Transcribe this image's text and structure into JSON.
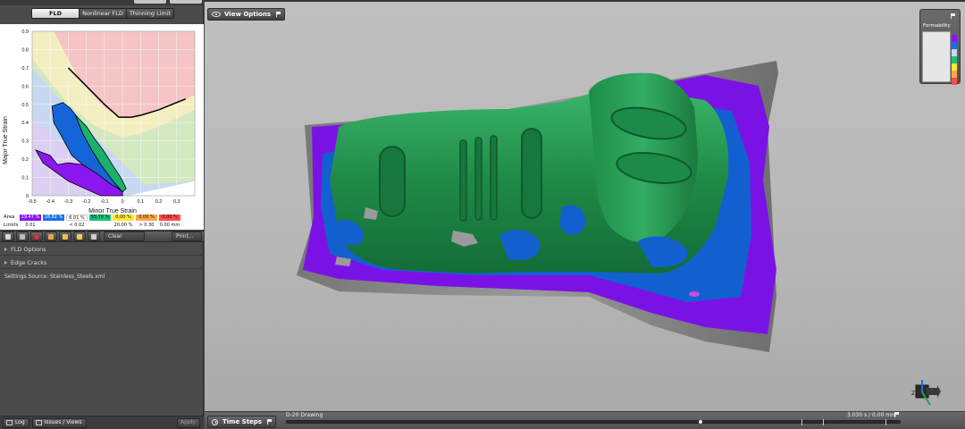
{
  "fld": {
    "tabs": [
      {
        "label": "FLD",
        "active": true
      },
      {
        "label": "Nonlinear FLD",
        "active": false
      },
      {
        "label": "Thinning Limit",
        "active": false
      }
    ],
    "chart_data": {
      "type": "scatter",
      "xlabel": "Minor True Strain",
      "ylabel": "Major True Strain",
      "xlim": [
        -0.5,
        0.4
      ],
      "ylim": [
        0,
        0.9
      ],
      "xticks": [
        "-0.5",
        "-0.4",
        "-0.3",
        "-0.2",
        "-0.1",
        "0",
        "0.1",
        "0.2",
        "0.3"
      ],
      "yticks": [
        "0",
        "0.1",
        "0.2",
        "0.3",
        "0.4",
        "0.5",
        "0.6",
        "0.7",
        "0.8",
        "0.9"
      ],
      "grid": true,
      "flc": {
        "x": [
          -0.3,
          -0.2,
          -0.1,
          -0.02,
          0.0,
          0.05,
          0.1,
          0.2,
          0.3,
          0.35
        ],
        "y": [
          0.7,
          0.6,
          0.5,
          0.43,
          0.43,
          0.43,
          0.44,
          0.47,
          0.51,
          0.53
        ]
      },
      "zone_colors": {
        "red": "#f5c4c6",
        "yellow": "#f3efc1",
        "green": "#d3e8c0",
        "blue": "#c7d8f2",
        "purple": "#ddcff1"
      },
      "point_colors": {
        "purple": "#8a16f0",
        "blue": "#1565d8",
        "green": "#1bb06d",
        "black": "#000000"
      }
    },
    "area_label": "Area",
    "limits_label": "Limits",
    "area": [
      {
        "value": "19.47 %",
        "color": "#8a16f0",
        "text": "#ffffff"
      },
      {
        "value": "18.82 %",
        "color": "#1a6ee6",
        "text": "#ffffff"
      },
      {
        "value": "6.01 %",
        "color": "#ffffff",
        "text": "#111111"
      },
      {
        "value": "55.70 %",
        "color": "#19c277",
        "text": "#111111"
      },
      {
        "value": "0.00 %",
        "color": "#ffe82e",
        "text": "#111111"
      },
      {
        "value": "0.00 %",
        "color": "#ffa64a",
        "text": "#111111"
      },
      {
        "value": "0.00 %",
        "color": "#ff4c4c",
        "text": "#111111"
      }
    ],
    "limits": [
      "0.01",
      "< 0.02",
      "20.00 %",
      "> 0.30",
      "0.00 mm"
    ],
    "toolbar": {
      "clear": "Clear",
      "print": "Print..."
    }
  },
  "panel": {
    "fld_options": "FLD Options",
    "edge_cracks": "Edge Cracks",
    "settings_source": "Settings Source:  Stainless_Steels.xml"
  },
  "bottom": {
    "log": "Log",
    "issues": "Issues / Views",
    "apply": "Apply"
  },
  "viewport": {
    "view_options": "View Options",
    "legend_title": "Formability",
    "legend_colors": [
      "#8a16f0",
      "#1a6ee6",
      "#c9d7ec",
      "#19c277",
      "#ffe82e",
      "#ffa64a",
      "#ff4c4c"
    ],
    "time_steps": "Time Steps",
    "stage_label": "D-20 Drawing",
    "time_readout": "3.030 s / 0.00 mm",
    "axes": {
      "x": "X",
      "z": "Z"
    }
  }
}
